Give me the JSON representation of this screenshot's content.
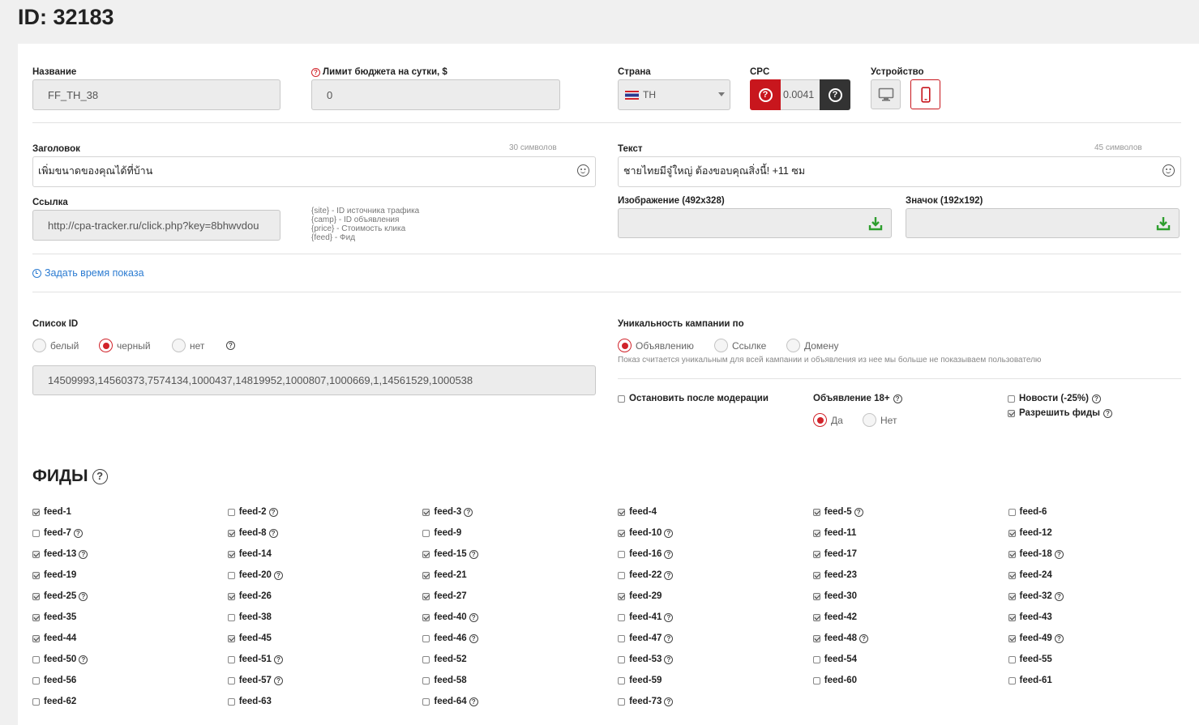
{
  "page": {
    "title": "ID: 32183"
  },
  "form": {
    "name": {
      "label": "Название",
      "value": "FF_TH_38"
    },
    "budget": {
      "label": "Лимит бюджета на сутки, $",
      "value": "0"
    },
    "country": {
      "label": "Страна",
      "value": "TH"
    },
    "cpc": {
      "label": "CPC",
      "value": "0.0041"
    },
    "device": {
      "label": "Устройство",
      "options": [
        "desktop",
        "mobile"
      ],
      "selected": "mobile"
    },
    "headline": {
      "label": "Заголовок",
      "counter": "30 символов",
      "value": "เพิ่มขนาดของคุณได้ที่บ้าน"
    },
    "text": {
      "label": "Текст",
      "counter": "45 символов",
      "value": "ชายไทยมีจู๋ใหญ่ ต้องขอบคุณสิ่งนี้! +11 ซม"
    },
    "link": {
      "label": "Ссылка",
      "value": "http://cpa-tracker.ru/click.php?key=8bhwvdou"
    },
    "macros": [
      "{site} - ID источника трафика",
      "{camp} - ID объявления",
      "{price} - Стоимость клика",
      "{feed} - Фид"
    ],
    "image": {
      "label": "Изображение (492x328)"
    },
    "icon": {
      "label": "Значок (192x192)"
    },
    "schedule_link": "Задать время показа",
    "id_list": {
      "label": "Список ID",
      "options": [
        "белый",
        "черный",
        "нет"
      ],
      "selected": "черный",
      "value": "14509993,14560373,7574134,1000437,14819952,1000807,1000669,1,14561529,1000538"
    },
    "uniqueness": {
      "label": "Уникальность кампании по",
      "options": [
        "Объявлению",
        "Ссылке",
        "Домену"
      ],
      "selected": "Объявлению",
      "note": "Показ считается уникальным для всей кампании и объявления из нее мы больше не показываем пользователю"
    },
    "stop_after_moderation": {
      "label": "Остановить после модерации",
      "checked": false
    },
    "adult": {
      "label": "Объявление 18+",
      "options": [
        "Да",
        "Нет"
      ],
      "selected": "Да"
    },
    "news": {
      "label": "Новости (-25%)",
      "checked": false
    },
    "allow_feeds": {
      "label": "Разрешить фиды",
      "checked": true
    }
  },
  "feeds": {
    "title": "ФИДЫ",
    "items": [
      {
        "name": "feed-1",
        "checked": true,
        "help": false
      },
      {
        "name": "feed-2",
        "checked": false,
        "help": true
      },
      {
        "name": "feed-3",
        "checked": true,
        "help": true
      },
      {
        "name": "feed-4",
        "checked": true,
        "help": false
      },
      {
        "name": "feed-5",
        "checked": true,
        "help": true
      },
      {
        "name": "feed-6",
        "checked": false,
        "help": false
      },
      {
        "name": "feed-7",
        "checked": false,
        "help": true
      },
      {
        "name": "feed-8",
        "checked": true,
        "help": true
      },
      {
        "name": "feed-9",
        "checked": false,
        "help": false
      },
      {
        "name": "feed-10",
        "checked": true,
        "help": true
      },
      {
        "name": "feed-11",
        "checked": true,
        "help": false
      },
      {
        "name": "feed-12",
        "checked": true,
        "help": false
      },
      {
        "name": "feed-13",
        "checked": true,
        "help": true
      },
      {
        "name": "feed-14",
        "checked": true,
        "help": false
      },
      {
        "name": "feed-15",
        "checked": true,
        "help": true
      },
      {
        "name": "feed-16",
        "checked": false,
        "help": true
      },
      {
        "name": "feed-17",
        "checked": true,
        "help": false
      },
      {
        "name": "feed-18",
        "checked": true,
        "help": true
      },
      {
        "name": "feed-19",
        "checked": true,
        "help": false
      },
      {
        "name": "feed-20",
        "checked": false,
        "help": true
      },
      {
        "name": "feed-21",
        "checked": true,
        "help": false
      },
      {
        "name": "feed-22",
        "checked": false,
        "help": true
      },
      {
        "name": "feed-23",
        "checked": true,
        "help": false
      },
      {
        "name": "feed-24",
        "checked": true,
        "help": false
      },
      {
        "name": "feed-25",
        "checked": true,
        "help": true
      },
      {
        "name": "feed-26",
        "checked": true,
        "help": false
      },
      {
        "name": "feed-27",
        "checked": true,
        "help": false
      },
      {
        "name": "feed-29",
        "checked": true,
        "help": false
      },
      {
        "name": "feed-30",
        "checked": true,
        "help": false
      },
      {
        "name": "feed-32",
        "checked": true,
        "help": true
      },
      {
        "name": "feed-35",
        "checked": true,
        "help": false
      },
      {
        "name": "feed-38",
        "checked": false,
        "help": false
      },
      {
        "name": "feed-40",
        "checked": true,
        "help": true
      },
      {
        "name": "feed-41",
        "checked": false,
        "help": true
      },
      {
        "name": "feed-42",
        "checked": true,
        "help": false
      },
      {
        "name": "feed-43",
        "checked": true,
        "help": false
      },
      {
        "name": "feed-44",
        "checked": true,
        "help": false
      },
      {
        "name": "feed-45",
        "checked": true,
        "help": false
      },
      {
        "name": "feed-46",
        "checked": false,
        "help": true
      },
      {
        "name": "feed-47",
        "checked": false,
        "help": true
      },
      {
        "name": "feed-48",
        "checked": true,
        "help": true
      },
      {
        "name": "feed-49",
        "checked": true,
        "help": true
      },
      {
        "name": "feed-50",
        "checked": false,
        "help": true
      },
      {
        "name": "feed-51",
        "checked": false,
        "help": true
      },
      {
        "name": "feed-52",
        "checked": false,
        "help": false
      },
      {
        "name": "feed-53",
        "checked": false,
        "help": true
      },
      {
        "name": "feed-54",
        "checked": false,
        "help": false
      },
      {
        "name": "feed-55",
        "checked": false,
        "help": false
      },
      {
        "name": "feed-56",
        "checked": false,
        "help": false
      },
      {
        "name": "feed-57",
        "checked": false,
        "help": true
      },
      {
        "name": "feed-58",
        "checked": false,
        "help": false
      },
      {
        "name": "feed-59",
        "checked": false,
        "help": false
      },
      {
        "name": "feed-60",
        "checked": false,
        "help": false
      },
      {
        "name": "feed-61",
        "checked": false,
        "help": false
      },
      {
        "name": "feed-62",
        "checked": false,
        "help": false
      },
      {
        "name": "feed-63",
        "checked": false,
        "help": false
      },
      {
        "name": "feed-64",
        "checked": false,
        "help": true
      },
      {
        "name": "feed-73",
        "checked": false,
        "help": true
      }
    ]
  },
  "colors": {
    "accent": "#c8161d",
    "link": "#2b7bd1",
    "download": "#2e9e2e"
  }
}
